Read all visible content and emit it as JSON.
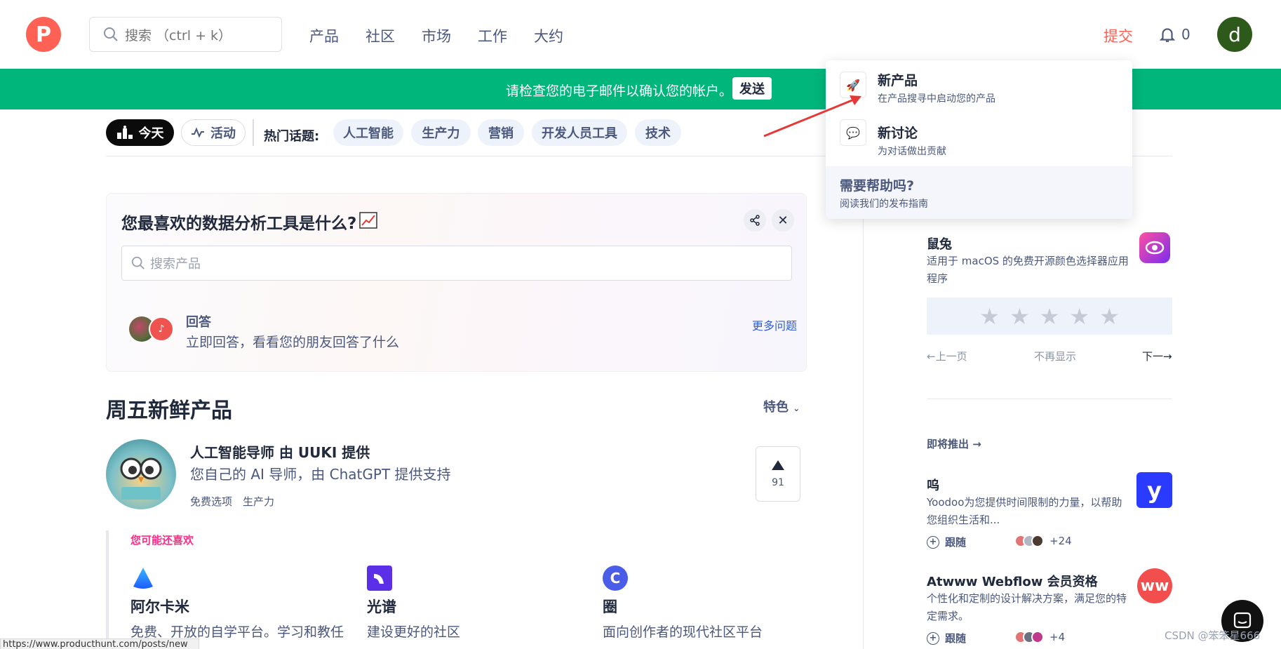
{
  "header": {
    "logo_letter": "P",
    "search_placeholder": "搜索 （ctrl + k）",
    "nav": [
      "产品",
      "社区",
      "市场",
      "工作",
      "大约"
    ],
    "submit": "提交",
    "notification_count": "0",
    "avatar_letter": "d"
  },
  "banner": {
    "text": "请检查您的电子邮件以确认您的帐户。",
    "button": "发送"
  },
  "filters": {
    "today": "今天",
    "activity": "活动",
    "hot_label": "热门话题:",
    "topics": [
      "人工智能",
      "生产力",
      "营销",
      "开发人员工具",
      "技术"
    ]
  },
  "question_card": {
    "title": "您最喜欢的数据分析工具是什么?",
    "search_placeholder": "搜索产品",
    "answer_title": "回答",
    "answer_sub": "立即回答，看看您的朋友回答了什么",
    "more": "更多问题"
  },
  "section": {
    "title": "周五新鲜产品",
    "sort": "特色"
  },
  "product": {
    "name": "人工智能导师 由 UUKI 提供",
    "desc": "您自己的 AI 导师，由 ChatGPT 提供支持",
    "tags": [
      "免费选项",
      "生产力"
    ],
    "votes": "91"
  },
  "also_like": {
    "title": "您可能还喜欢",
    "items": [
      {
        "name": "阿尔卡米",
        "desc": "免费、开放的自学平台。学习和教任"
      },
      {
        "name": "光谱",
        "desc": "建设更好的社区"
      },
      {
        "name": "圈",
        "desc": "面向创作者的现代社区平台",
        "logo_letter": "C"
      }
    ]
  },
  "status_url": "https://www.producthunt.com/posts/new",
  "sidebar": {
    "review": {
      "name": "鼠兔",
      "desc": "适用于 macOS 的免费开源颜色选择器应用程序",
      "stars": [
        "★",
        "★",
        "★",
        "★",
        "★"
      ],
      "prev": "←上一页",
      "dont_show": "不再显示",
      "next": "下一→"
    },
    "coming_soon": "即将推出 →",
    "upcoming": [
      {
        "name": "呜",
        "desc": "Yoodoo为您提供时间限制的力量，以帮助您组织生活和...",
        "follow": "跟随",
        "count": "+24",
        "logo_letter": "y"
      },
      {
        "name": "Atwww Webflow 会员资格",
        "desc": "个性化和定制的设计解决方案，满足您的特定需求。",
        "follow": "跟随",
        "count": "+4",
        "logo_letter": "ww"
      }
    ]
  },
  "dropdown": {
    "items": [
      {
        "title": "新产品",
        "sub": "在产品搜寻中启动您的产品"
      },
      {
        "title": "新讨论",
        "sub": "为对话做出贡献"
      }
    ],
    "help_title": "需要帮助吗?",
    "help_sub": "阅读我们的发布指南"
  },
  "watermark": "CSDN @笨笨星666",
  "colors": {
    "brand": "#ff6154",
    "banner": "#00b67a",
    "link": "#2e5dd8",
    "also_title": "#ff2d87"
  }
}
